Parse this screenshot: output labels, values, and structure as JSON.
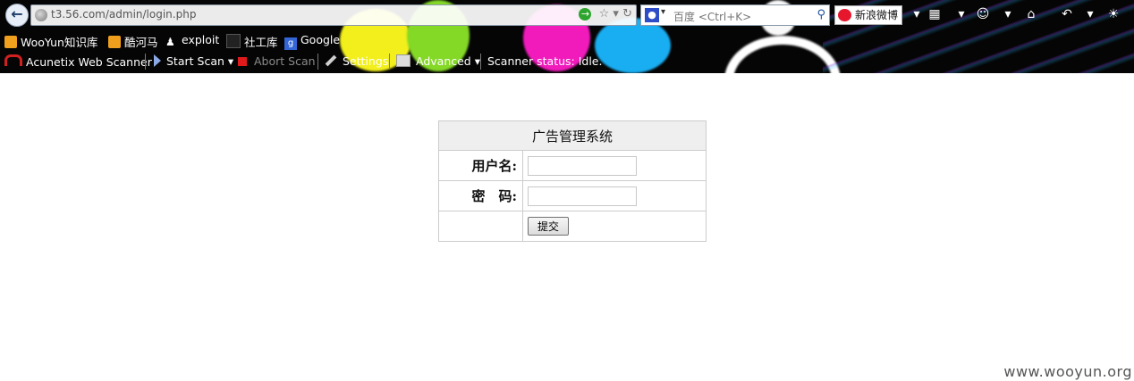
{
  "browser": {
    "url": "t3.56.com/admin/login.php",
    "search_engine": "百度",
    "search_placeholder": "<Ctrl+K>",
    "weibo_label": "新浪微博",
    "colors": {
      "toolbar_bg": "#050505",
      "accent_yellow": "#f3ef1c",
      "accent_pink": "#f11bbc",
      "accent_cyan": "#19aef1"
    }
  },
  "bookmarks": [
    {
      "label": "WooYun知识库",
      "icon": "rss-icon"
    },
    {
      "label": "酷河马",
      "icon": "rss-icon"
    },
    {
      "label": "exploit",
      "icon": "person-icon"
    },
    {
      "label": "社工库",
      "icon": "dark-icon"
    },
    {
      "label": "Google",
      "icon": "google-icon"
    }
  ],
  "acunetix": {
    "title": "Acunetix Web Scanner",
    "start_scan": "Start Scan",
    "abort_scan": "Abort Scan",
    "settings": "Settings",
    "advanced": "Advanced",
    "status": "Scanner status: Idle."
  },
  "login": {
    "title": "广告管理系统",
    "username_label": "用户名:",
    "password_label": "密　码:",
    "submit_label": "提交",
    "username_value": "",
    "password_value": ""
  },
  "watermark": "www.wooyun.org"
}
